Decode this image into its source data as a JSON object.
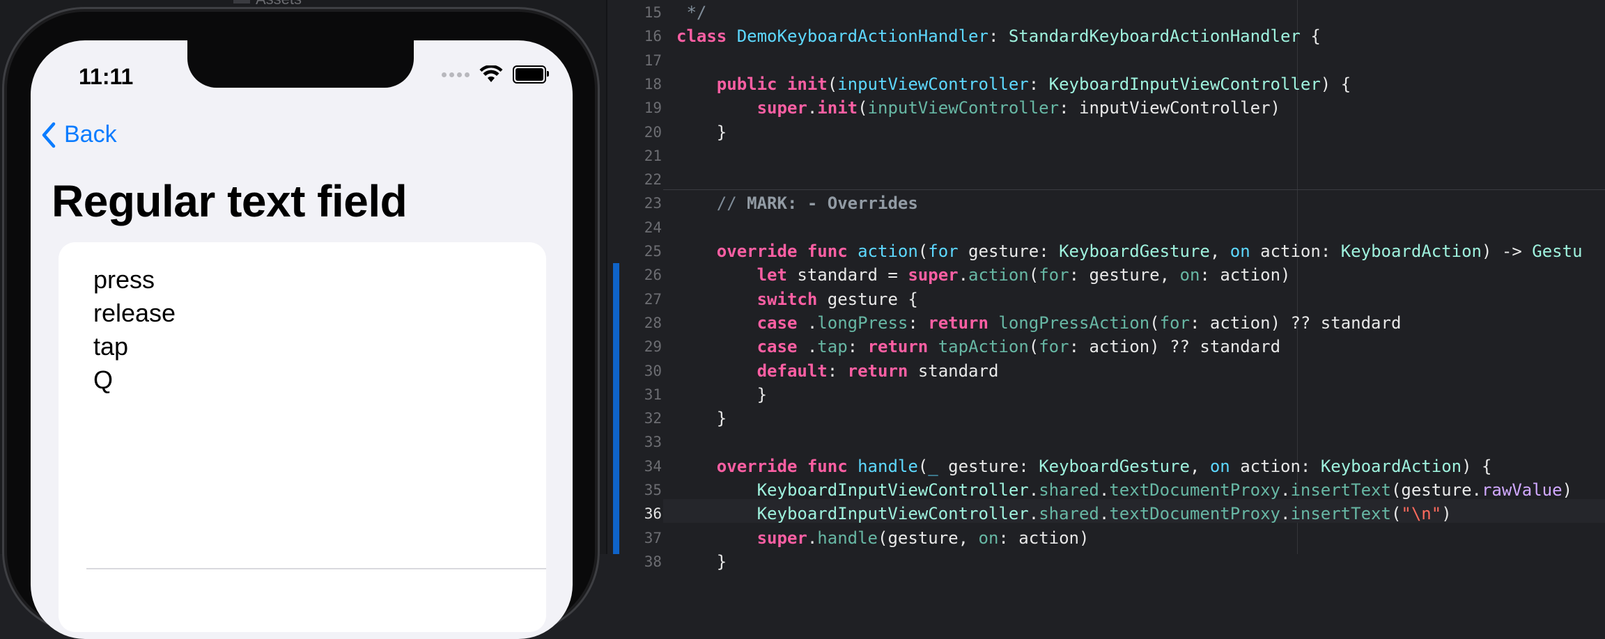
{
  "simulator": {
    "status_bar": {
      "time": "11:11"
    },
    "nav": {
      "back_label": "Back"
    },
    "title": "Regular text field",
    "text_lines": [
      "press",
      "release",
      "tap",
      "Q"
    ],
    "colors": {
      "accent": "#0a7cff",
      "background": "#f2f2f7"
    },
    "top_label": "Assets"
  },
  "editor": {
    "current_line": 36,
    "colors": {
      "keyword": "#fc5fa3",
      "type": "#9ef1dd",
      "declaration": "#5dd8ff",
      "function": "#67b7a4",
      "string": "#fc6a5d",
      "property": "#d0a8ff",
      "comment": "#7f8c98"
    },
    "lines": [
      {
        "n": "15",
        "tokens": [
          {
            "t": " */",
            "c": "cm"
          }
        ]
      },
      {
        "n": "16",
        "tokens": [
          {
            "t": "class ",
            "c": "kw"
          },
          {
            "t": "DemoKeyboardActionHandler",
            "c": "dn"
          },
          {
            "t": ": ",
            "c": "pl"
          },
          {
            "t": "StandardKeyboardActionHandler",
            "c": "ty"
          },
          {
            "t": " {",
            "c": "pl"
          }
        ]
      },
      {
        "n": "17",
        "tokens": []
      },
      {
        "n": "18",
        "tokens": [
          {
            "t": "    ",
            "c": "pl"
          },
          {
            "t": "public ",
            "c": "kw"
          },
          {
            "t": "init",
            "c": "kw"
          },
          {
            "t": "(",
            "c": "pl"
          },
          {
            "t": "inputViewController",
            "c": "dn"
          },
          {
            "t": ": ",
            "c": "pl"
          },
          {
            "t": "KeyboardInputViewController",
            "c": "ty"
          },
          {
            "t": ") {",
            "c": "pl"
          }
        ]
      },
      {
        "n": "19",
        "tokens": [
          {
            "t": "        ",
            "c": "pl"
          },
          {
            "t": "super",
            "c": "kw"
          },
          {
            "t": ".",
            "c": "pl"
          },
          {
            "t": "init",
            "c": "kw"
          },
          {
            "t": "(",
            "c": "pl"
          },
          {
            "t": "inputViewController",
            "c": "fn"
          },
          {
            "t": ": inputViewController)",
            "c": "pl"
          }
        ]
      },
      {
        "n": "20",
        "tokens": [
          {
            "t": "    }",
            "c": "pl"
          }
        ]
      },
      {
        "n": "21",
        "tokens": []
      },
      {
        "n": "22",
        "tokens": []
      },
      {
        "n": "23",
        "tokens": [
          {
            "t": "    // ",
            "c": "cm"
          },
          {
            "t": "MARK: - Overrides",
            "c": "cmb"
          }
        ]
      },
      {
        "n": "24",
        "tokens": []
      },
      {
        "n": "25",
        "tokens": [
          {
            "t": "    ",
            "c": "pl"
          },
          {
            "t": "override ",
            "c": "kw"
          },
          {
            "t": "func ",
            "c": "kw"
          },
          {
            "t": "action",
            "c": "dn"
          },
          {
            "t": "(",
            "c": "pl"
          },
          {
            "t": "for",
            "c": "dn"
          },
          {
            "t": " gesture: ",
            "c": "pl"
          },
          {
            "t": "KeyboardGesture",
            "c": "ty"
          },
          {
            "t": ", ",
            "c": "pl"
          },
          {
            "t": "on",
            "c": "dn"
          },
          {
            "t": " action: ",
            "c": "pl"
          },
          {
            "t": "KeyboardAction",
            "c": "ty"
          },
          {
            "t": ") -> ",
            "c": "pl"
          },
          {
            "t": "Gestu",
            "c": "ty"
          }
        ]
      },
      {
        "n": "26",
        "tokens": [
          {
            "t": "        ",
            "c": "pl"
          },
          {
            "t": "let ",
            "c": "kw"
          },
          {
            "t": "standard = ",
            "c": "pl"
          },
          {
            "t": "super",
            "c": "kw"
          },
          {
            "t": ".",
            "c": "pl"
          },
          {
            "t": "action",
            "c": "fn"
          },
          {
            "t": "(",
            "c": "pl"
          },
          {
            "t": "for",
            "c": "fn"
          },
          {
            "t": ": gesture, ",
            "c": "pl"
          },
          {
            "t": "on",
            "c": "fn"
          },
          {
            "t": ": action)",
            "c": "pl"
          }
        ]
      },
      {
        "n": "27",
        "tokens": [
          {
            "t": "        ",
            "c": "pl"
          },
          {
            "t": "switch ",
            "c": "kw"
          },
          {
            "t": "gesture {",
            "c": "pl"
          }
        ]
      },
      {
        "n": "28",
        "tokens": [
          {
            "t": "        ",
            "c": "pl"
          },
          {
            "t": "case ",
            "c": "kw"
          },
          {
            "t": ".",
            "c": "pl"
          },
          {
            "t": "longPress",
            "c": "fn"
          },
          {
            "t": ": ",
            "c": "pl"
          },
          {
            "t": "return ",
            "c": "kw"
          },
          {
            "t": "longPressAction",
            "c": "fn"
          },
          {
            "t": "(",
            "c": "pl"
          },
          {
            "t": "for",
            "c": "fn"
          },
          {
            "t": ": action) ?? standard",
            "c": "pl"
          }
        ]
      },
      {
        "n": "29",
        "tokens": [
          {
            "t": "        ",
            "c": "pl"
          },
          {
            "t": "case ",
            "c": "kw"
          },
          {
            "t": ".",
            "c": "pl"
          },
          {
            "t": "tap",
            "c": "fn"
          },
          {
            "t": ": ",
            "c": "pl"
          },
          {
            "t": "return ",
            "c": "kw"
          },
          {
            "t": "tapAction",
            "c": "fn"
          },
          {
            "t": "(",
            "c": "pl"
          },
          {
            "t": "for",
            "c": "fn"
          },
          {
            "t": ": action) ?? standard",
            "c": "pl"
          }
        ]
      },
      {
        "n": "30",
        "tokens": [
          {
            "t": "        ",
            "c": "pl"
          },
          {
            "t": "default",
            "c": "kw"
          },
          {
            "t": ": ",
            "c": "pl"
          },
          {
            "t": "return ",
            "c": "kw"
          },
          {
            "t": "standard",
            "c": "pl"
          }
        ]
      },
      {
        "n": "31",
        "tokens": [
          {
            "t": "        }",
            "c": "pl"
          }
        ]
      },
      {
        "n": "32",
        "tokens": [
          {
            "t": "    }",
            "c": "pl"
          }
        ]
      },
      {
        "n": "33",
        "tokens": []
      },
      {
        "n": "34",
        "tokens": [
          {
            "t": "    ",
            "c": "pl"
          },
          {
            "t": "override ",
            "c": "kw"
          },
          {
            "t": "func ",
            "c": "kw"
          },
          {
            "t": "handle",
            "c": "dn"
          },
          {
            "t": "(",
            "c": "pl"
          },
          {
            "t": "_",
            "c": "dn"
          },
          {
            "t": " gesture: ",
            "c": "pl"
          },
          {
            "t": "KeyboardGesture",
            "c": "ty"
          },
          {
            "t": ", ",
            "c": "pl"
          },
          {
            "t": "on",
            "c": "dn"
          },
          {
            "t": " action: ",
            "c": "pl"
          },
          {
            "t": "KeyboardAction",
            "c": "ty"
          },
          {
            "t": ") {",
            "c": "pl"
          }
        ]
      },
      {
        "n": "35",
        "tokens": [
          {
            "t": "        ",
            "c": "pl"
          },
          {
            "t": "KeyboardInputViewController",
            "c": "ty"
          },
          {
            "t": ".",
            "c": "pl"
          },
          {
            "t": "shared",
            "c": "fn"
          },
          {
            "t": ".",
            "c": "pl"
          },
          {
            "t": "textDocumentProxy",
            "c": "fn"
          },
          {
            "t": ".",
            "c": "pl"
          },
          {
            "t": "insertText",
            "c": "fn"
          },
          {
            "t": "(gesture.",
            "c": "pl"
          },
          {
            "t": "rawValue",
            "c": "pp"
          },
          {
            "t": ")",
            "c": "pl"
          }
        ]
      },
      {
        "n": "36",
        "tokens": [
          {
            "t": "        ",
            "c": "pl"
          },
          {
            "t": "KeyboardInputViewController",
            "c": "ty"
          },
          {
            "t": ".",
            "c": "pl"
          },
          {
            "t": "shared",
            "c": "fn"
          },
          {
            "t": ".",
            "c": "pl"
          },
          {
            "t": "textDocumentProxy",
            "c": "fn"
          },
          {
            "t": ".",
            "c": "pl"
          },
          {
            "t": "insertText",
            "c": "fn"
          },
          {
            "t": "(",
            "c": "pl"
          },
          {
            "t": "\"\\n\"",
            "c": "st"
          },
          {
            "t": ")",
            "c": "pl"
          }
        ]
      },
      {
        "n": "37",
        "tokens": [
          {
            "t": "        ",
            "c": "pl"
          },
          {
            "t": "super",
            "c": "kw"
          },
          {
            "t": ".",
            "c": "pl"
          },
          {
            "t": "handle",
            "c": "fn"
          },
          {
            "t": "(gesture, ",
            "c": "pl"
          },
          {
            "t": "on",
            "c": "fn"
          },
          {
            "t": ": action)",
            "c": "pl"
          }
        ]
      },
      {
        "n": "38",
        "tokens": [
          {
            "t": "    }",
            "c": "pl"
          }
        ]
      }
    ]
  }
}
